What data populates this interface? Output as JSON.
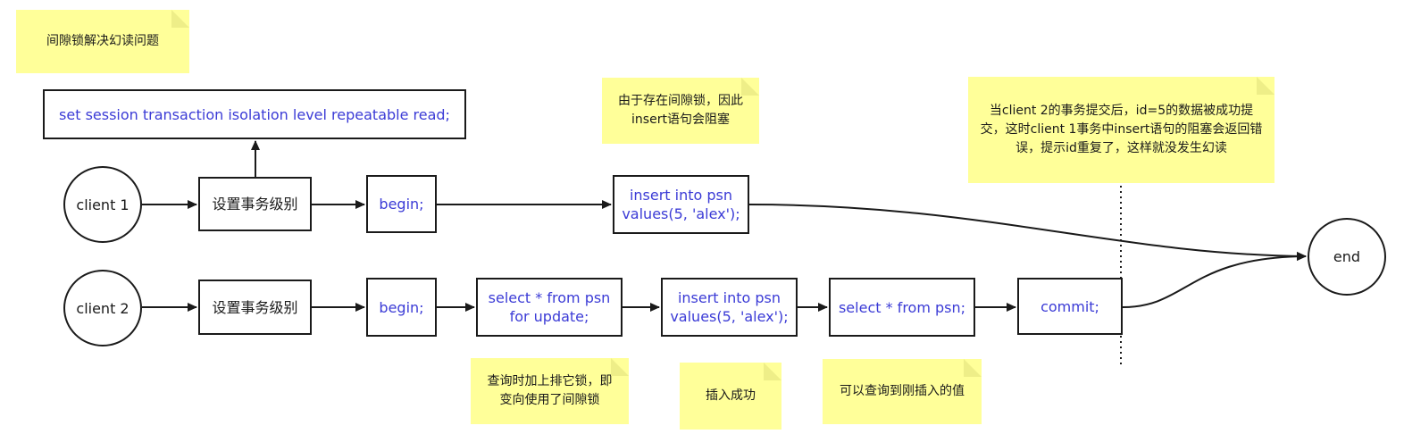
{
  "notes": {
    "gap_lock_title": "间隙锁解决幻读问题",
    "blocked_note": "由于存在间隙锁，因此insert语句会阻塞",
    "commit_note": "当client 2的事务提交后，id=5的数据被成功提交，这时client 1事务中insert语句的阻塞会返回错误，提示id重复了，这样就没发生幻读",
    "lock_note": "查询时加上排它锁，即变向使用了间隙锁",
    "insert_success_note": "插入成功",
    "query_note": "可以查询到刚插入的值"
  },
  "client1": {
    "circle_label": "client 1",
    "set_level": "设置事务级别",
    "begin": "begin;",
    "insert": "insert into psn values(5, 'alex');"
  },
  "client2": {
    "circle_label": "client 2",
    "set_level": "设置事务级别",
    "begin": "begin;",
    "select_for_update": "select * from psn for update;",
    "insert": "insert into psn values(5, 'alex');",
    "select": "select * from psn;",
    "commit": "commit;"
  },
  "session_statement": "set session transaction isolation level repeatable read;",
  "end_label": "end",
  "colors": {
    "note_bg": "#ffff99",
    "code_text": "#3b3bd6",
    "stroke": "#1a1a1a"
  }
}
